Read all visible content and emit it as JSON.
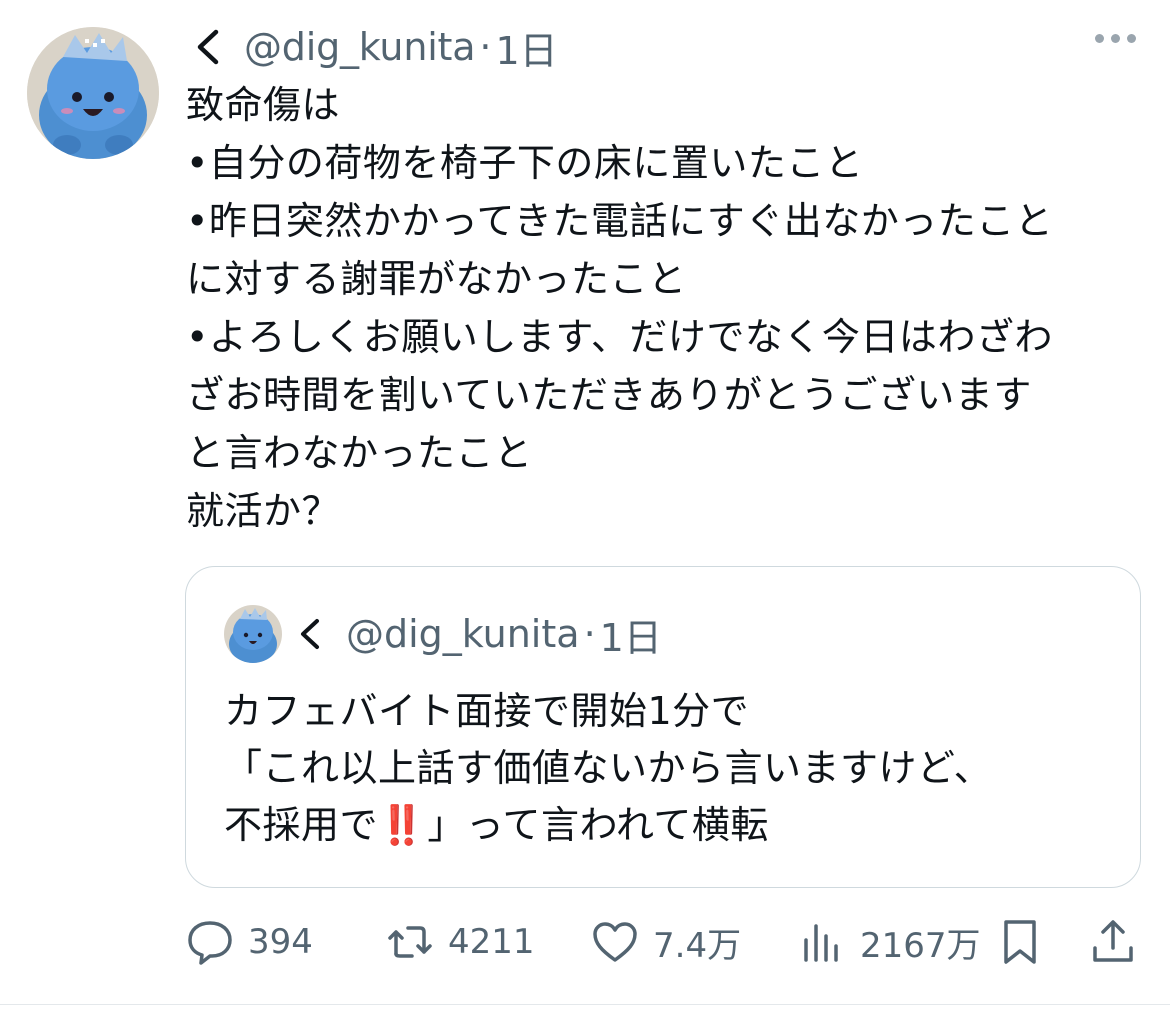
{
  "tweet": {
    "handle": "@dig_kunita",
    "separator": "·",
    "time": "1日",
    "lines": [
      "致命傷は",
      "•自分の荷物を椅子下の床に置いたこと",
      "•昨日突然かかってきた電話にすぐ出なかったこと",
      "に対する謝罪がなかったこと",
      "•よろしくお願いします、だけでなく今日はわざわ",
      "ざお時間を割いていただきありがとうございます",
      "と言わなかったこと",
      "就活か？"
    ]
  },
  "quote": {
    "handle": "@dig_kunita",
    "separator": "·",
    "time": "1日",
    "line1": "カフェバイト面接で開始1分で",
    "line2": "「これ以上話す価値ないから言いますけど、",
    "line3_pre": "不採用で",
    "line3_emoji": "‼️",
    "line3_post": "」って言われて横転"
  },
  "actions": {
    "replies": "394",
    "retweets": "4211",
    "likes": "7.4万",
    "views": "2167万"
  },
  "icons": {
    "back": "chevron-left-icon",
    "more": "more-horizontal-icon",
    "reply": "reply-icon",
    "retweet": "retweet-icon",
    "like": "heart-icon",
    "views": "bar-chart-icon",
    "bookmark": "bookmark-icon",
    "share": "share-icon"
  },
  "colors": {
    "text": "#0f1419",
    "secondary": "#536471",
    "border": "#cfd9de",
    "emoji_red": "#e0241b"
  }
}
